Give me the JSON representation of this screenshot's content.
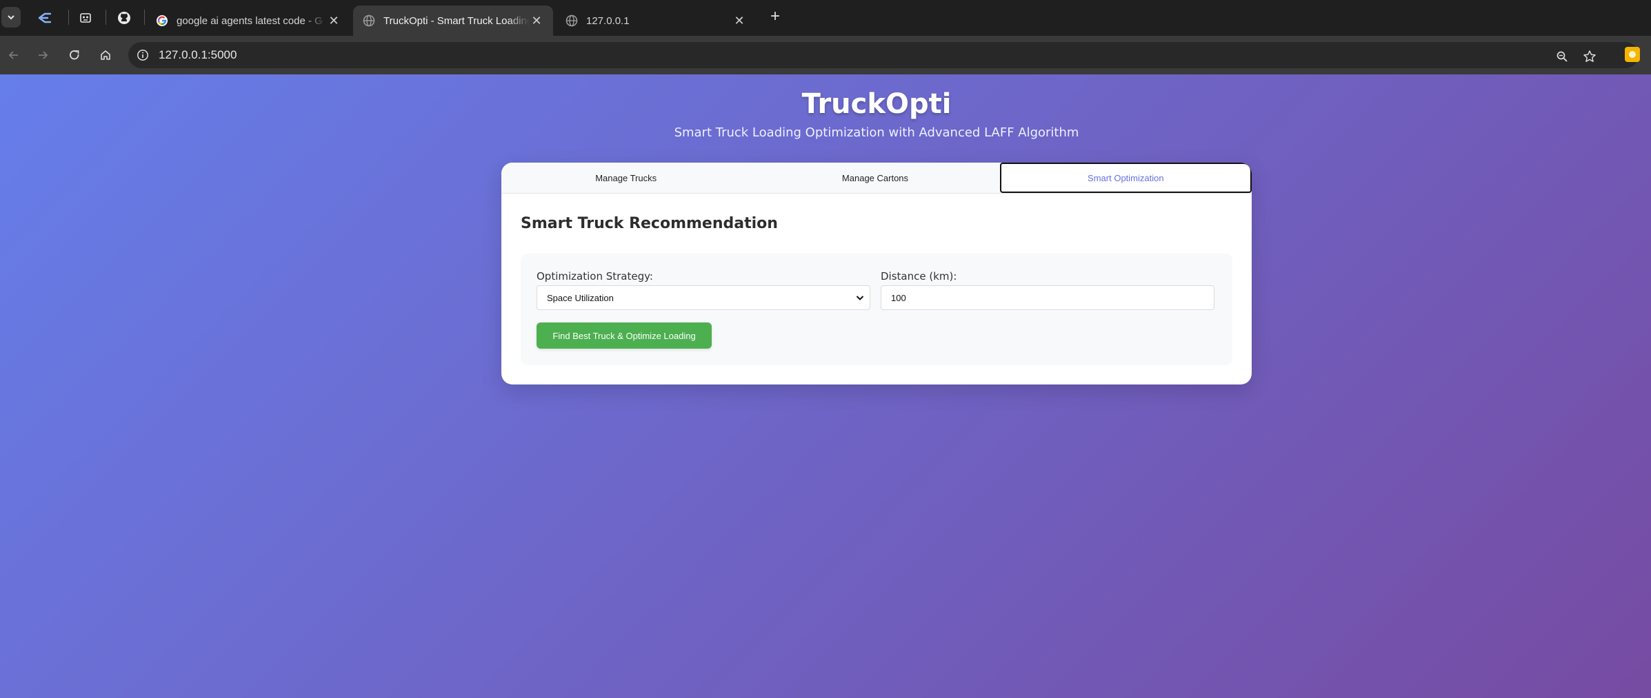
{
  "browser": {
    "tabs": [
      {
        "title": "google ai agents latest code - G",
        "active": false,
        "favicon": "google-icon"
      },
      {
        "title": "TruckOpti - Smart Truck Loading",
        "active": true,
        "favicon": "globe-icon"
      },
      {
        "title": "127.0.0.1",
        "active": false,
        "favicon": "globe-icon"
      }
    ],
    "close_glyph": "✕",
    "new_tab_glyph": "+",
    "url": "127.0.0.1:5000",
    "colors": {
      "tabbar": "#1f1f1f",
      "toolbar": "#3a3a3a",
      "omnibox": "#282828"
    }
  },
  "app": {
    "title": "TruckOpti",
    "subtitle": "Smart Truck Loading Optimization with Advanced LAFF Algorithm",
    "tabs": [
      {
        "label": "Manage Trucks",
        "active": false
      },
      {
        "label": "Manage Cartons",
        "active": false
      },
      {
        "label": "Smart Optimization",
        "active": true
      }
    ],
    "section_title": "Smart Truck Recommendation",
    "form": {
      "strategy_label": "Optimization Strategy:",
      "strategy_value": "Space Utilization",
      "distance_label": "Distance (km):",
      "distance_value": "100",
      "submit_label": "Find Best Truck & Optimize Loading"
    },
    "colors": {
      "gradient_start": "#667eea",
      "gradient_end": "#764ba2",
      "active_tab_text": "#6672e4",
      "button": "#4caf50"
    }
  }
}
